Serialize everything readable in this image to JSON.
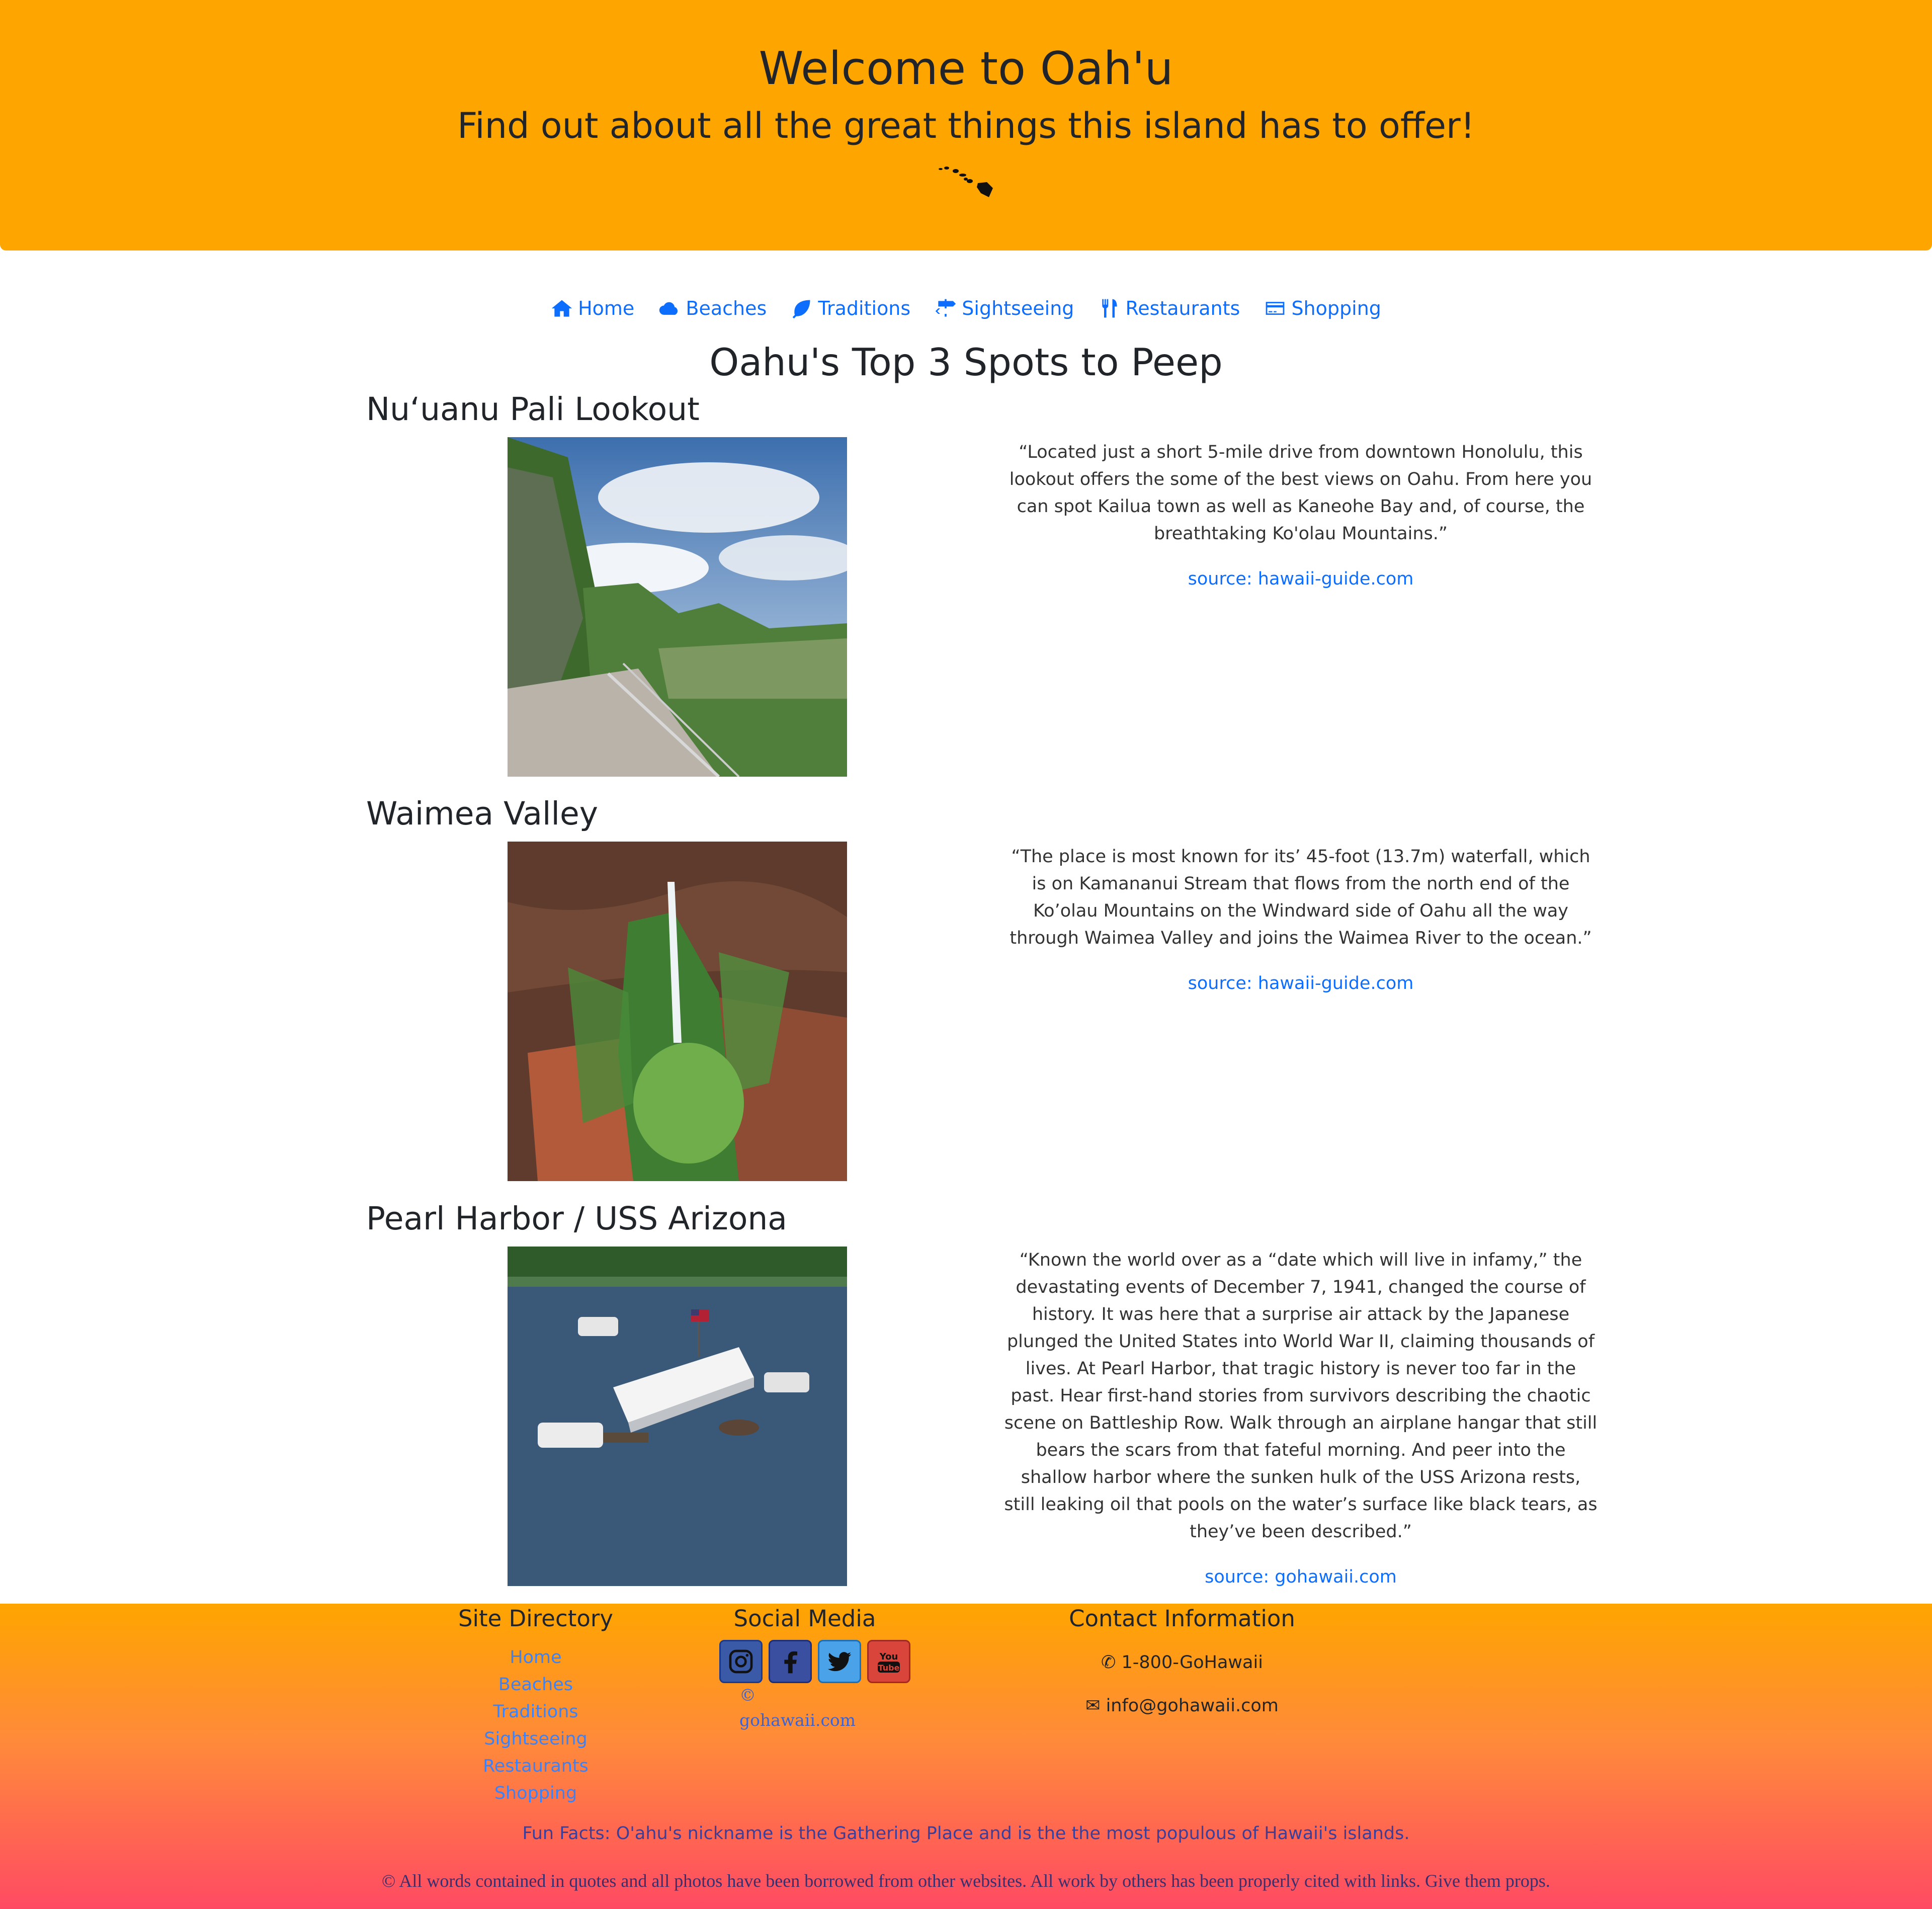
{
  "header": {
    "title": "Welcome to Oah'u",
    "subtitle": "Find out about all the great things this island has to offer!",
    "icon": "hawaii-islands-icon"
  },
  "nav": {
    "items": [
      {
        "label": "Home",
        "icon": "home-icon"
      },
      {
        "label": "Beaches",
        "icon": "cloud-icon"
      },
      {
        "label": "Traditions",
        "icon": "leaf-icon"
      },
      {
        "label": "Sightseeing",
        "icon": "signpost-icon"
      },
      {
        "label": "Restaurants",
        "icon": "utensils-icon"
      },
      {
        "label": "Shopping",
        "icon": "credit-card-icon"
      }
    ]
  },
  "main": {
    "title": "Oahu's Top 3 Spots to Peep",
    "spots": [
      {
        "title": "Nuʻuanu Pali Lookout",
        "quote": "“Located just a short 5-mile drive from downtown Honolulu, this lookout offers the some of the best views on Oahu. From here you can spot Kailua town as well as Kaneohe Bay and, of course, the breathtaking Ko'olau Mountains.”",
        "source": "source: hawaii-guide.com"
      },
      {
        "title": "Waimea Valley",
        "quote": "“The place is most known for its’ 45-foot (13.7m) waterfall, which is on Kamananui Stream that flows from the north end of the Ko’olau Mountains on the Windward side of Oahu all the way through Waimea Valley and joins the Waimea River to the ocean.”",
        "source": "source: hawaii-guide.com"
      },
      {
        "title": "Pearl Harbor / USS Arizona",
        "quote": "“Known the world over as a “date which will live in infamy,” the devastating events of December 7, 1941, changed the course of history. It was here that a surprise air attack by the Japanese plunged the United States into World War II, claiming thousands of lives. At Pearl Harbor, that tragic history is never too far in the past. Hear first-hand stories from survivors describing the chaotic scene on Battleship Row. Walk through an airplane hangar that still bears the scars from that fateful morning. And peer into the shallow harbor where the sunken hulk of the USS Arizona rests, still leaking oil that pools on the water’s surface like black tears, as they’ve been described.”",
        "source": "source: gohawaii.com"
      }
    ]
  },
  "footer": {
    "directory_title": "Site Directory",
    "directory": [
      "Home",
      "Beaches",
      "Traditions",
      "Sightseeing",
      "Restaurants",
      "Shopping"
    ],
    "social_title": "Social Media",
    "social_icons": [
      "instagram-icon",
      "facebook-icon",
      "twitter-icon",
      "youtube-icon"
    ],
    "copyright_link": "© gohawaii.com",
    "contact_title": "Contact Information",
    "phone": "1-800-GoHawaii",
    "email": "info@gohawaii.com",
    "fun_facts": "Fun Facts: O'ahu's nickname is the Gathering Place and is the the most populous of Hawaii's islands.",
    "credits": "© All words contained in quotes and all photos have been borrowed from other websites. All work by others has been properly cited with links. Give them props."
  },
  "colors": {
    "header_bg": "#ffa500",
    "link": "#0d6efd",
    "footer_gradient_end": "#ff4a64"
  }
}
